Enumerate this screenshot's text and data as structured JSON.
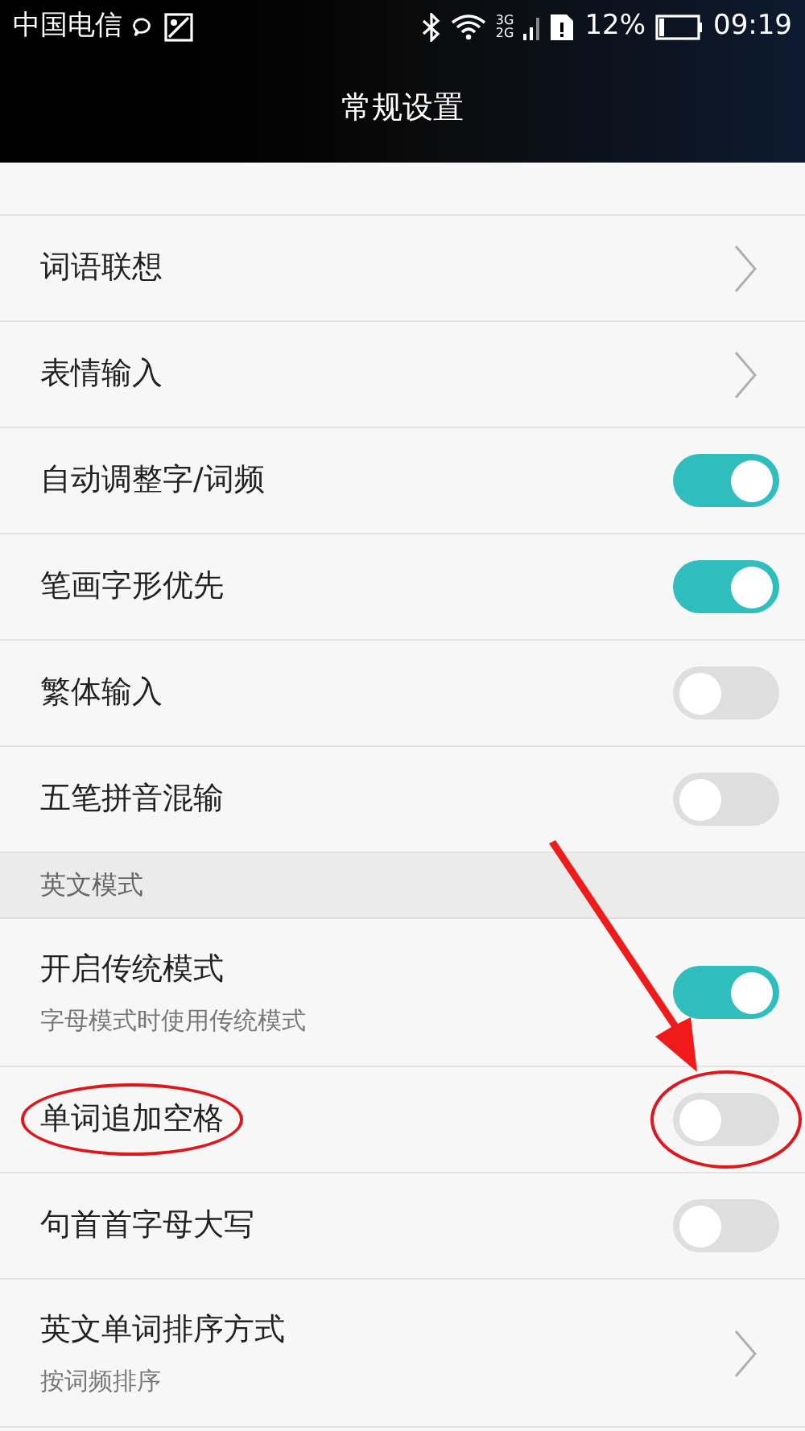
{
  "status_bar": {
    "carrier": "中国电信",
    "network_3g": "3G",
    "network_2g": "2G",
    "battery": "12%",
    "time": "09:19"
  },
  "header": {
    "title": "常规设置"
  },
  "items": [
    {
      "kind": "link",
      "label": "词语联想",
      "highlighted": false
    },
    {
      "kind": "link",
      "label": "表情输入",
      "highlighted": false
    },
    {
      "kind": "toggle",
      "label": "自动调整字/词频",
      "on": true,
      "highlighted": false
    },
    {
      "kind": "toggle",
      "label": "笔画字形优先",
      "on": true,
      "highlighted": false
    },
    {
      "kind": "toggle",
      "label": "繁体输入",
      "on": false,
      "highlighted": false
    },
    {
      "kind": "toggle",
      "label": "五笔拼音混输",
      "on": false,
      "highlighted": false
    },
    {
      "kind": "section",
      "label": "英文模式"
    },
    {
      "kind": "toggle",
      "label": "开启传统模式",
      "subtitle": "字母模式时使用传统模式",
      "on": true,
      "highlighted": false
    },
    {
      "kind": "toggle",
      "label": "单词追加空格",
      "on": false,
      "highlighted": true
    },
    {
      "kind": "toggle",
      "label": "句首首字母大写",
      "on": false,
      "highlighted": false
    },
    {
      "kind": "link",
      "label": "英文单词排序方式",
      "subtitle": "按词频排序",
      "highlighted": false
    }
  ]
}
